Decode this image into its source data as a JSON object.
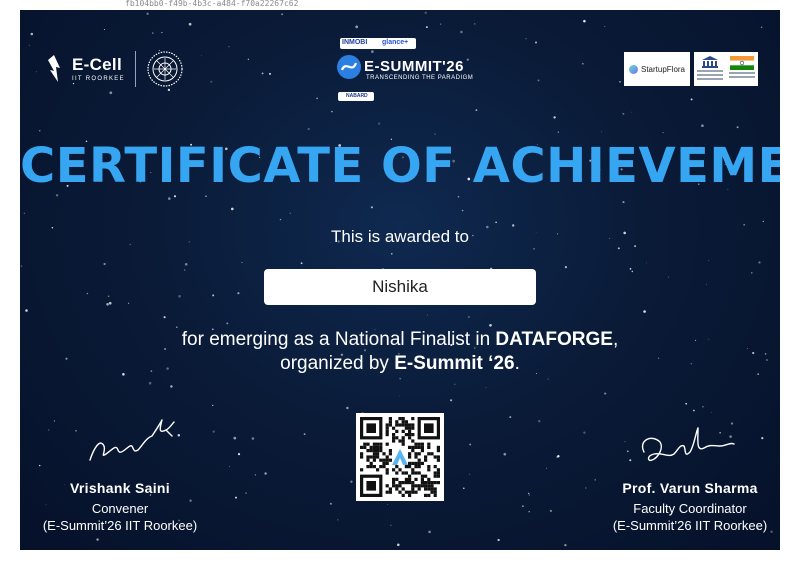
{
  "url_fragment": "fb104bb0-f49b-4b3c-a484-f70a22267c62",
  "logos": {
    "ecell_name": "E-Cell",
    "ecell_sub": "IIT ROORKEE",
    "inmobi": "INMOBI",
    "glance": "glance+",
    "esummit_title": "E-SUMMIT'26",
    "esummit_tagline": "TRANSCENDING THE PARADIGM",
    "nabard": "NABARD",
    "startupflora": "StartupFlora"
  },
  "certificate": {
    "title": "CERTIFICATE OF ACHIEVEMENT",
    "awarded_to": "This is awarded to",
    "recipient": "Nishika",
    "reason_prefix": "for emerging as a National Finalist in ",
    "event": "DATAFORGE",
    "reason_middle": ",",
    "reason_line2_prefix": "organized by ",
    "organizer": "E-Summit ‘26",
    "reason_suffix": "."
  },
  "signatories": [
    {
      "name": "Vrishank Saini",
      "role": "Convener",
      "org": "(E-Summit’26 IIT Roorkee)"
    },
    {
      "name": "Prof. Varun Sharma",
      "role": "Faculty Coordinator",
      "org": "(E-Summit’26 IIT Roorkee)"
    }
  ],
  "colors": {
    "title": "#37a6f2",
    "background": "#0a1b38",
    "text": "#ffffff",
    "esummit_blue": "#2b7fe0"
  },
  "icons": {
    "ecell_logo": "rocket-flame-icon",
    "iitr_seal": "iit-roorkee-seal-icon",
    "esummit_globe": "esummit-globe-icon",
    "unesco": "unesco-temple-icon",
    "india_flag": "india-flag-icon",
    "qr": "qr-code-icon"
  }
}
